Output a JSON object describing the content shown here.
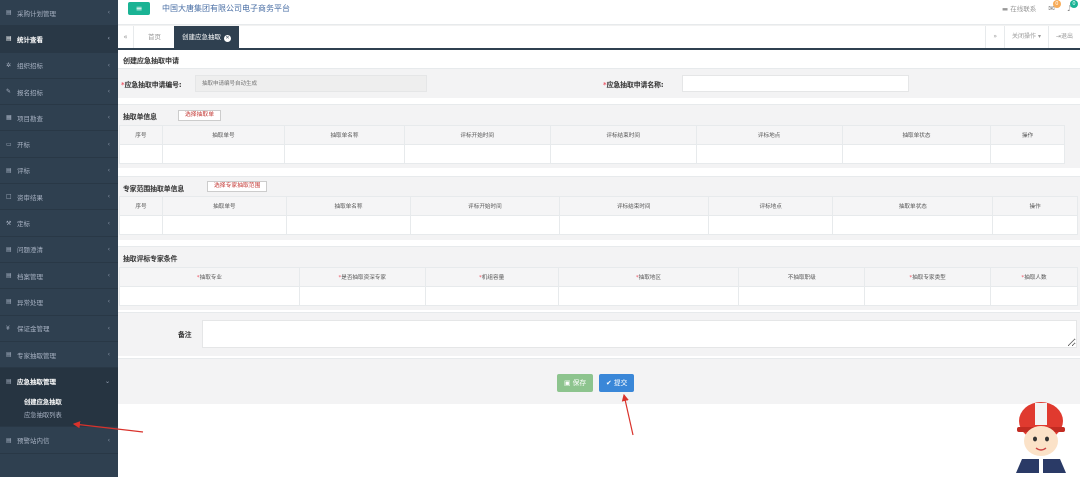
{
  "header": {
    "menu_icon": "hamburger-icon",
    "platform_title": "中国大唐集团有限公司电子商务平台",
    "online_contact": "在线联系",
    "message_count": "0",
    "notice_count": "0"
  },
  "sidebar": {
    "items": [
      {
        "label": "采购计划管理",
        "icon": "doc-icon"
      },
      {
        "label": "统计查看",
        "icon": "doc-icon"
      },
      {
        "label": "组织招标",
        "icon": "gear-icon"
      },
      {
        "label": "报名招标",
        "icon": "edit-icon"
      },
      {
        "label": "项目勘查",
        "icon": "building-icon"
      },
      {
        "label": "开标",
        "icon": "monitor-icon"
      },
      {
        "label": "评标",
        "icon": "doc-icon"
      },
      {
        "label": "资审结果",
        "icon": "square-icon"
      },
      {
        "label": "定标",
        "icon": "tools-icon"
      },
      {
        "label": "问题澄清",
        "icon": "doc-icon"
      },
      {
        "label": "档案管理",
        "icon": "doc-icon"
      },
      {
        "label": "异常处理",
        "icon": "doc-icon"
      },
      {
        "label": "保证金管理",
        "icon": "yen-icon"
      },
      {
        "label": "专家抽取管理",
        "icon": "doc-icon"
      },
      {
        "label": "应急抽取管理",
        "icon": "doc-icon"
      }
    ],
    "sub_items": [
      "创建应急抽取",
      "应急抽取列表"
    ],
    "last_item": {
      "label": "预警站内信",
      "icon": "doc-icon"
    }
  },
  "tabs": {
    "home": "首页",
    "active": "创建应急抽取",
    "close_ops": "关闭操作",
    "logout": "退出"
  },
  "form": {
    "panel_title": "创建应急抽取申请",
    "apply_no_label": "应急抽取申请编号:",
    "apply_no_placeholder": "抽取申请编号自动生成",
    "apply_name_label": "应急抽取申请名称:",
    "apply_name_value": ""
  },
  "extract_section": {
    "title": "抽取单信息",
    "button": "选择抽取单",
    "columns": [
      "序号",
      "抽取单号",
      "抽取单名称",
      "评标开始时间",
      "评标结束时间",
      "评标地点",
      "抽取单状态",
      "操作"
    ]
  },
  "scope_section": {
    "title": "专家范围抽取单信息",
    "button": "选择专家抽取范围",
    "columns": [
      "序号",
      "抽取单号",
      "抽取单名称",
      "评标开始时间",
      "评标结束时间",
      "评标地点",
      "抽取单状态",
      "操作"
    ]
  },
  "condition_section": {
    "title": "抽取评标专家条件",
    "columns": [
      {
        "label": "抽取专业",
        "required": true
      },
      {
        "label": "是否抽取资深专家",
        "required": true
      },
      {
        "label": "机组容量",
        "required": true
      },
      {
        "label": "抽取地区",
        "required": true
      },
      {
        "label": "不抽取职级",
        "required": false
      },
      {
        "label": "抽取专家类型",
        "required": true
      },
      {
        "label": "抽取人数",
        "required": true
      }
    ]
  },
  "remark_label": "备注",
  "actions": {
    "save": "保存",
    "submit": "提交"
  },
  "colors": {
    "sidebar_bg": "#2f4050",
    "accent_green": "#1ab394",
    "save_btn": "#8dc48e",
    "submit_btn": "#3a87d8",
    "annotation_arrow": "#d9322b"
  }
}
